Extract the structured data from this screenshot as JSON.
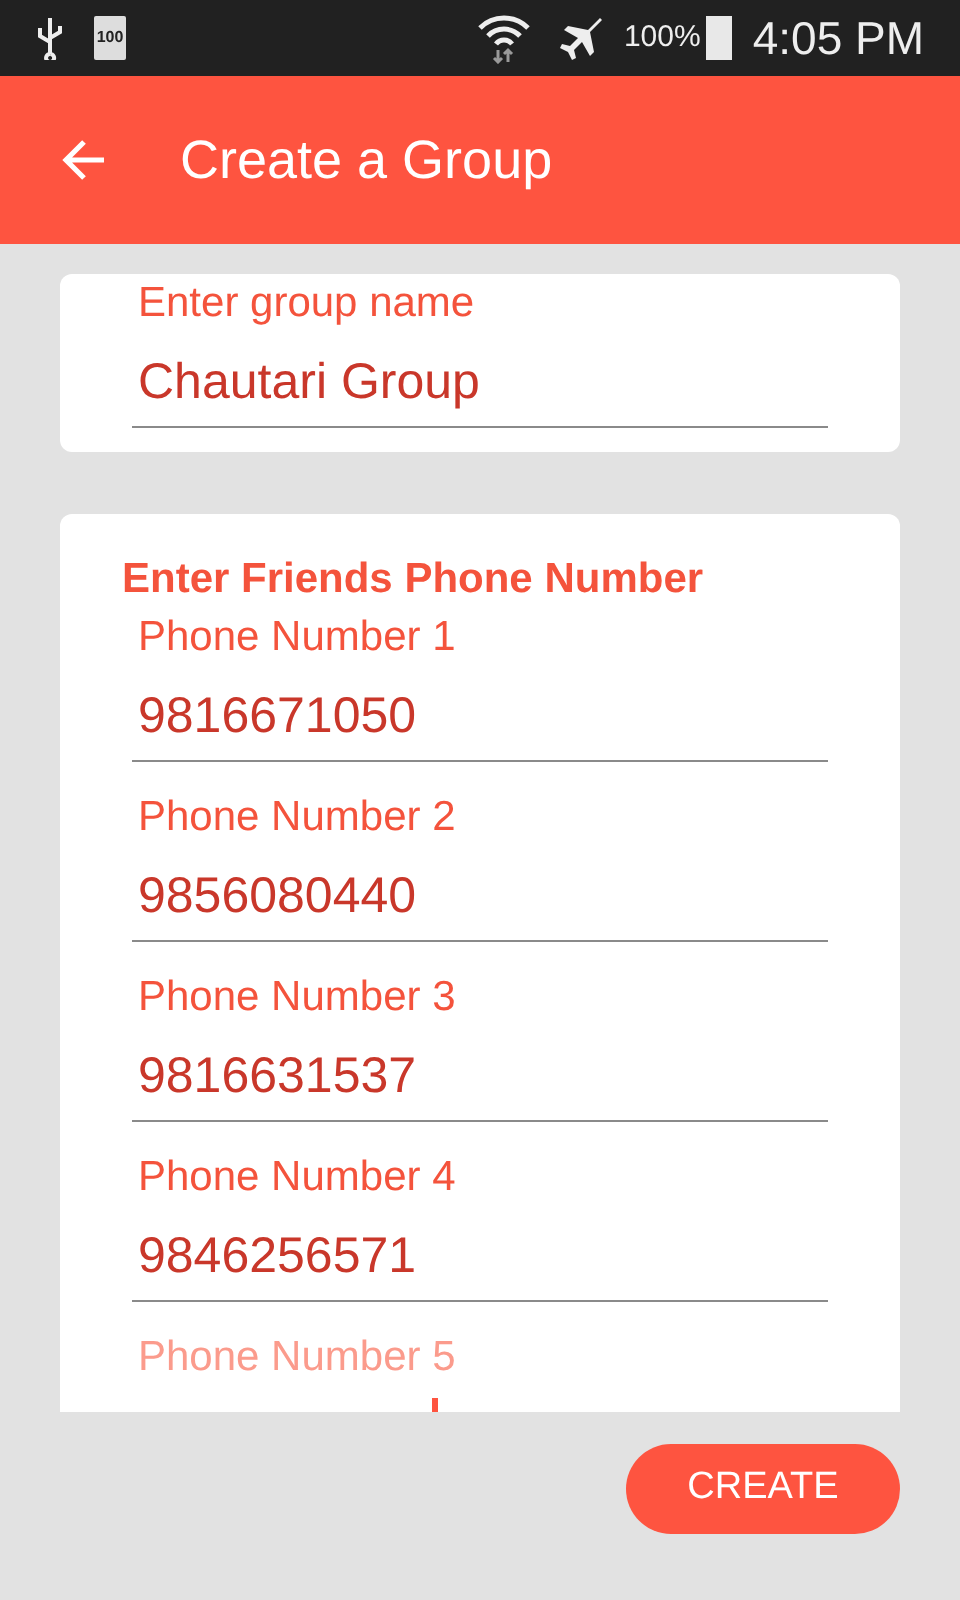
{
  "status_bar": {
    "battery_badge": "100",
    "battery_percent": "100%",
    "time": "4:05 PM"
  },
  "app_bar": {
    "title": "Create a Group"
  },
  "group_card": {
    "field": {
      "label": "Enter group name",
      "value": "Chautari Group",
      "focused": false
    }
  },
  "phone_card": {
    "title": "Enter Friends Phone Number",
    "fields": [
      {
        "label": "Phone Number 1",
        "value": "9816671050",
        "focused": false
      },
      {
        "label": "Phone Number 2",
        "value": "9856080440",
        "focused": false
      },
      {
        "label": "Phone Number 3",
        "value": "9816631537",
        "focused": false
      },
      {
        "label": "Phone Number 4",
        "value": "9846256571",
        "focused": false
      },
      {
        "label": "Phone Number 5",
        "focused": true
      }
    ]
  },
  "create_button": "CREATE"
}
